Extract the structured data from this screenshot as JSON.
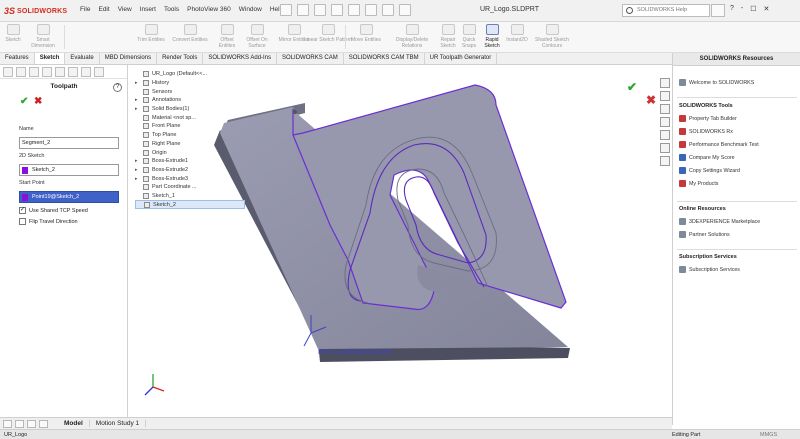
{
  "app": {
    "logo_text": "SOLIDWORKS",
    "document_title": "UR_Logo.SLDPRT"
  },
  "menu": [
    "File",
    "Edit",
    "View",
    "Insert",
    "Tools",
    "PhotoView 360",
    "Window",
    "Help"
  ],
  "search": {
    "placeholder": "SOLIDWORKS Help"
  },
  "window_controls": [
    "?",
    "-",
    "☐",
    "✕"
  ],
  "ribbon": {
    "buttons": [
      {
        "label": "Sketch"
      },
      {
        "label": "Smart Dimension"
      },
      {
        "label": "Trim Entities"
      },
      {
        "label": "Convert Entities"
      },
      {
        "label": "Offset Entities"
      },
      {
        "label": "Offset On Surface"
      },
      {
        "label": "Mirror Entities"
      },
      {
        "label": "Linear Sketch Pattern"
      },
      {
        "label": "Move Entities"
      },
      {
        "label": "Display/Delete Relations"
      },
      {
        "label": "Repair Sketch"
      },
      {
        "label": "Quick Snaps"
      },
      {
        "label": "Rapid Sketch"
      },
      {
        "label": "Instant2D"
      },
      {
        "label": "Shaded Sketch Contours"
      }
    ]
  },
  "tabs": [
    "Features",
    "Sketch",
    "Evaluate",
    "MBD Dimensions",
    "Render Tools",
    "SOLIDWORKS Add-Ins",
    "SOLIDWORKS CAM",
    "SOLIDWORKS CAM TBM",
    "UR Toolpath Generator"
  ],
  "property_manager": {
    "title": "Toolpath",
    "name_label": "Name",
    "name_value": "Segment_2",
    "sketch_label": "2D Sketch",
    "sketch_value": "Sketch_2",
    "start_label": "Start Point",
    "start_value": "Point19@Sketch_2",
    "use_tcp_label": "Use Shared TCP Speed",
    "flip_label": "Flip Travel Direction",
    "use_tcp_checked": true,
    "flip_checked": false,
    "selection_color": "#8b10d8"
  },
  "feature_tree": [
    {
      "label": "UR_Logo  (Default<<...",
      "expander": ""
    },
    {
      "label": "History",
      "expander": "▸"
    },
    {
      "label": "Sensors",
      "expander": ""
    },
    {
      "label": "Annotations",
      "expander": "▸"
    },
    {
      "label": "Solid Bodies(1)",
      "expander": "▸"
    },
    {
      "label": "Material <not sp...",
      "expander": ""
    },
    {
      "label": "Front Plane",
      "expander": ""
    },
    {
      "label": "Top Plane",
      "expander": ""
    },
    {
      "label": "Right Plane",
      "expander": ""
    },
    {
      "label": "Origin",
      "expander": ""
    },
    {
      "label": "Boss-Extrude1",
      "expander": "▸"
    },
    {
      "label": "Boss-Extrude2",
      "expander": "▸"
    },
    {
      "label": "Boss-Extrude3",
      "expander": "▸"
    },
    {
      "label": "Part Coordinate ...",
      "expander": ""
    },
    {
      "label": "Sketch_1",
      "expander": ""
    },
    {
      "label": "Sketch_2",
      "expander": ""
    }
  ],
  "viewport": {
    "coord_label": "Part Coordinate System",
    "model_color": "#8e8fa4",
    "highlight_color": "#6a2fd4"
  },
  "resources": {
    "title": "SOLIDWORKS Resources",
    "welcome": "Welcome to SOLIDWORKS",
    "tools_title": "SOLIDWORKS Tools",
    "tools": [
      "Property Tab Builder",
      "SOLIDWORKS Rx",
      "Performance Benchmark Test",
      "Compare My Score",
      "Copy Settings Wizard",
      "My Products"
    ],
    "online_title": "Online Resources",
    "online": [
      "3DEXPERIENCE Marketplace",
      "Partner Solutions"
    ],
    "subs_title": "Subscription Services",
    "subs": [
      "Subscription Services"
    ]
  },
  "bottom_tabs": [
    "Model",
    "Motion Study 1"
  ],
  "status": {
    "left": "UR_Logo",
    "mode": "Editing Part",
    "units": "MMGS"
  }
}
